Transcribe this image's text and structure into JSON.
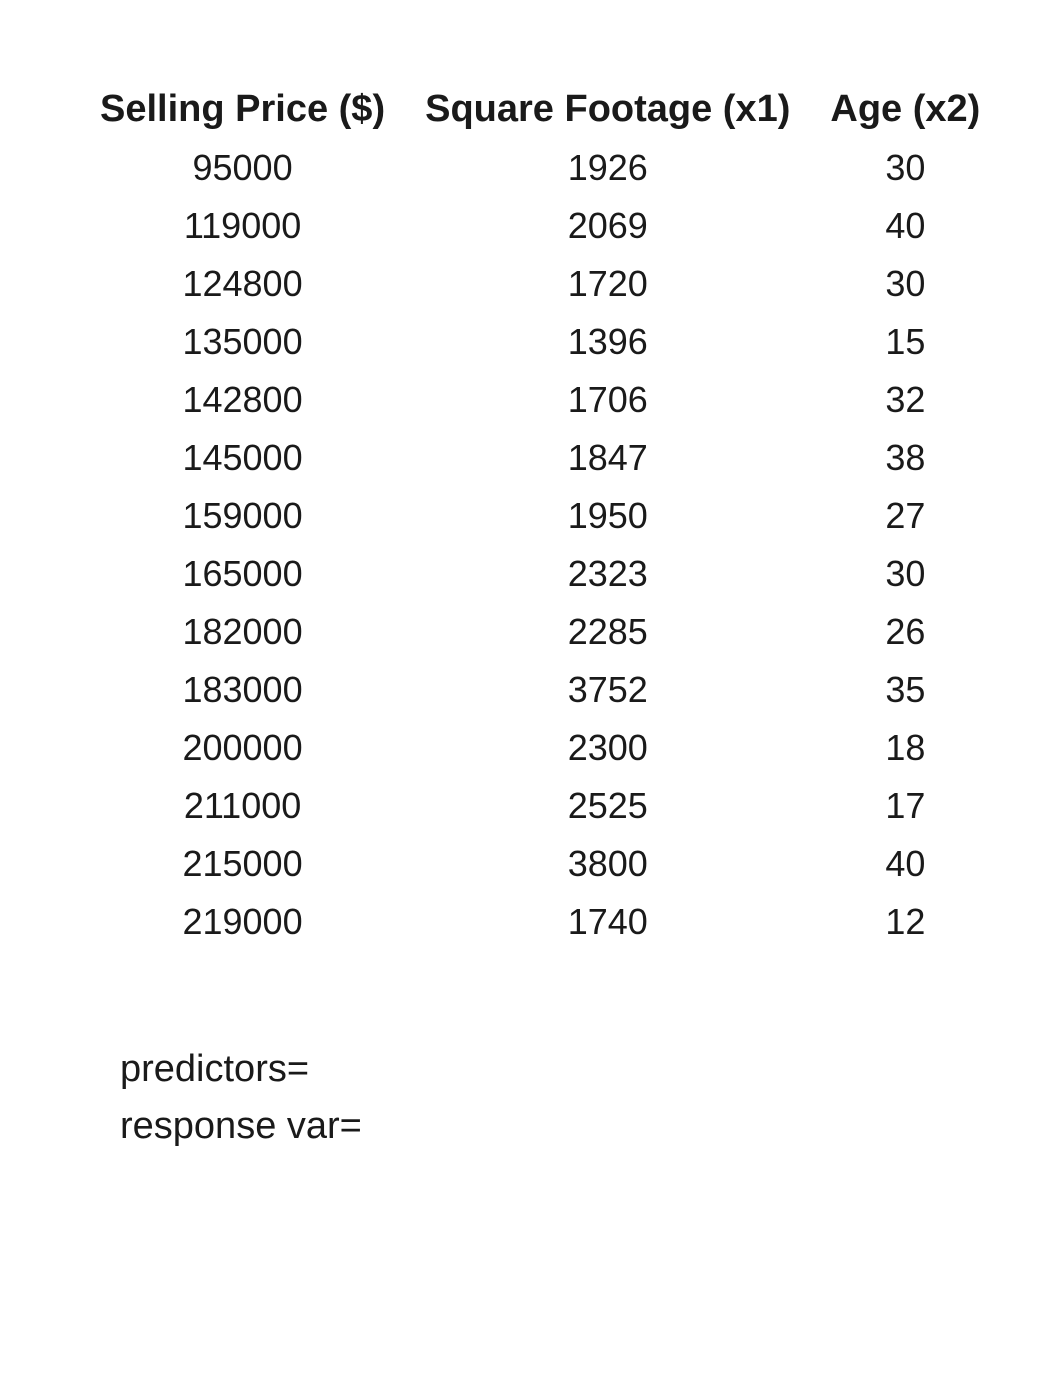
{
  "chart_data": {
    "type": "table",
    "columns": [
      "Selling Price ($)",
      "Square Footage (x1)",
      "Age (x2)"
    ],
    "rows": [
      [
        95000,
        1926,
        30
      ],
      [
        119000,
        2069,
        40
      ],
      [
        124800,
        1720,
        30
      ],
      [
        135000,
        1396,
        15
      ],
      [
        142800,
        1706,
        32
      ],
      [
        145000,
        1847,
        38
      ],
      [
        159000,
        1950,
        27
      ],
      [
        165000,
        2323,
        30
      ],
      [
        182000,
        2285,
        26
      ],
      [
        183000,
        3752,
        35
      ],
      [
        200000,
        2300,
        18
      ],
      [
        211000,
        2525,
        17
      ],
      [
        215000,
        3800,
        40
      ],
      [
        219000,
        1740,
        12
      ]
    ]
  },
  "notes": {
    "line1": "predictors=",
    "line2": "response var="
  }
}
